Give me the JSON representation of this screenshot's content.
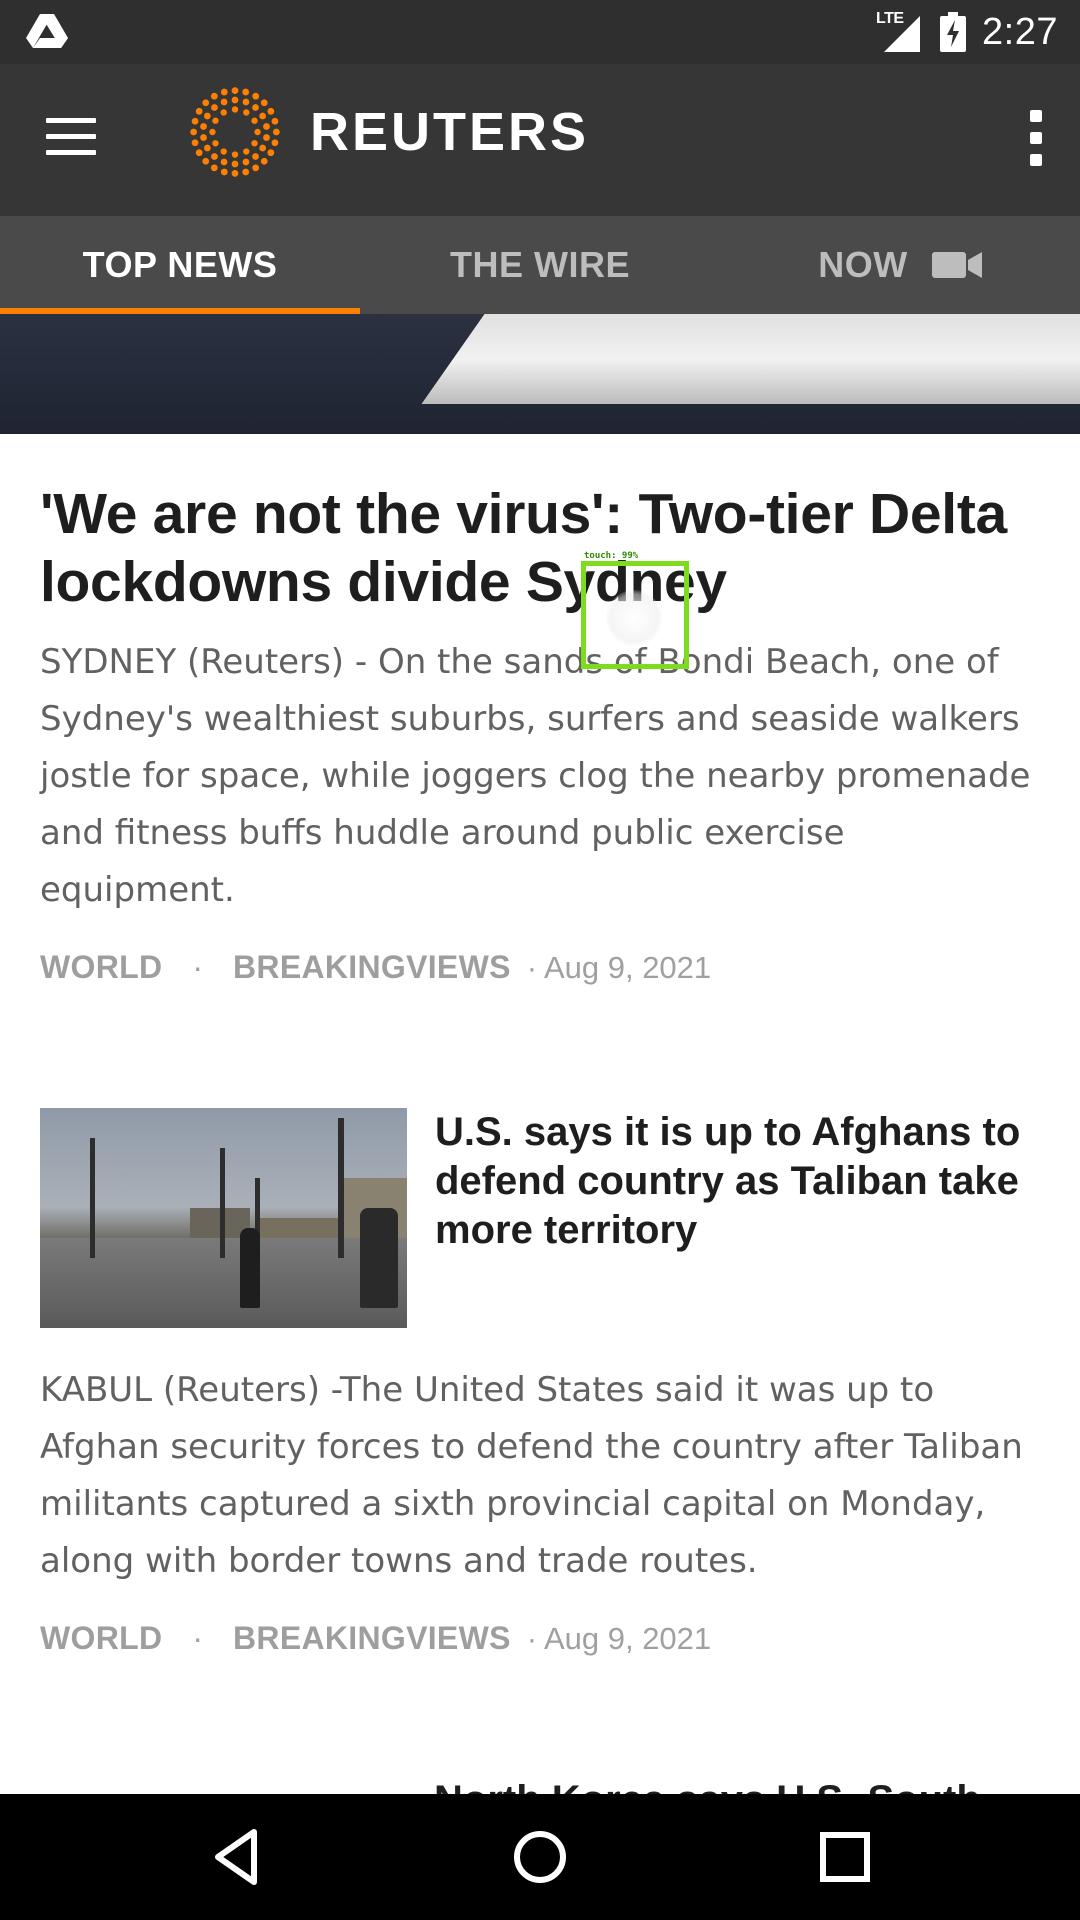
{
  "status_bar": {
    "network": "LTE",
    "time": "2:27",
    "icons": [
      "drive-icon",
      "signal-icon",
      "battery-charging-icon"
    ]
  },
  "app_bar": {
    "brand": "REUTERS",
    "brand_color": "#ff8000",
    "icons": [
      "menu-icon",
      "reuters-logo",
      "overflow-menu-icon"
    ]
  },
  "tabs": [
    {
      "label": "TOP NEWS",
      "active": true
    },
    {
      "label": "THE WIRE",
      "active": false
    },
    {
      "label": "NOW",
      "active": false,
      "icon": "video-camera-icon"
    }
  ],
  "articles": [
    {
      "headline": "'We are not the virus': Two-tier Delta lockdowns divide Sydney",
      "summary": "SYDNEY (Reuters) -     On the sands of Bondi Beach, one of Sydney's wealthiest suburbs, surfers and seaside walkers jostle for space, while joggers clog the nearby promenade and fitness buffs huddle around public exercise equipment.",
      "tags": [
        "WORLD",
        "BREAKINGVIEWS"
      ],
      "date": "Aug 9, 2021"
    },
    {
      "headline": "U.S. says it is up to Afghans to defend country as Taliban take more territory",
      "summary": "KABUL (Reuters) -The United States said it was up to Afghan security forces to defend the country after Taliban militants captured a sixth provincial capital on Monday, along with border towns and trade routes.",
      "tags": [
        "WORLD",
        "BREAKINGVIEWS"
      ],
      "date": "Aug 9, 2021"
    },
    {
      "headline": "North Korea says U.S.-South"
    }
  ],
  "meta_separator": "·",
  "touch_overlay": {
    "label": "touch: 99%"
  },
  "nav_bar": {
    "icons": [
      "back-icon",
      "home-icon",
      "recents-icon"
    ]
  }
}
